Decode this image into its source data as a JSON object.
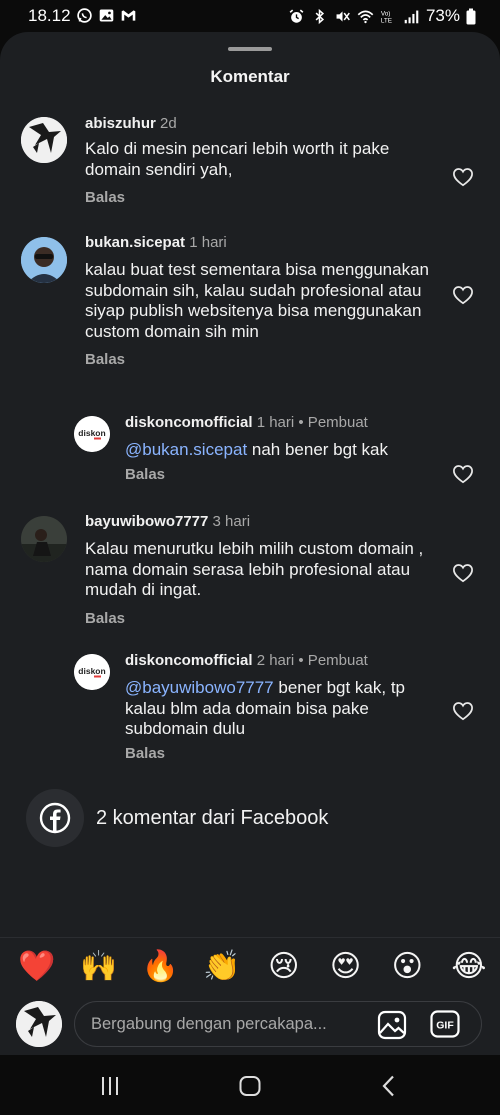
{
  "status": {
    "time": "18.12",
    "battery": "73%"
  },
  "sheet": {
    "title": "Komentar"
  },
  "comments": [
    {
      "username": "abiszuhur",
      "meta": "2d",
      "text": "Kalo di mesin pencari lebih worth it pake domain sendiri yah,",
      "reply_label": "Balas"
    },
    {
      "username": "bukan.sicepat",
      "meta": "1 hari",
      "text": "kalau buat test sementara bisa menggunakan subdomain sih, kalau sudah profesional atau siyap publish websitenya bisa menggunakan custom domain sih min",
      "reply_label": "Balas"
    },
    {
      "username": "diskoncomofficial",
      "meta": "1 hari • Pembuat",
      "mention": "@bukan.sicepat",
      "text": " nah bener bgt kak",
      "reply_label": "Balas"
    },
    {
      "username": "bayuwibowo7777",
      "meta": "3 hari",
      "text": "Kalau menurutku lebih milih custom domain , nama domain serasa lebih profesional atau mudah di ingat.",
      "reply_label": "Balas"
    },
    {
      "username": "diskoncomofficial",
      "meta": "2 hari • Pembuat",
      "mention": "@bayuwibowo7777",
      "text": " bener bgt kak, tp kalau blm ada domain bisa pake subdomain dulu",
      "reply_label": "Balas"
    }
  ],
  "facebook": {
    "label": "2 komentar dari Facebook"
  },
  "emojis": [
    "❤️",
    "🙌",
    "🔥",
    "👏",
    "😢",
    "😍",
    "😮",
    "😂"
  ],
  "composer": {
    "placeholder": "Bergabung dengan percakapa..."
  },
  "logo_text": "diskon",
  "colors": {
    "background": "#1d1f22",
    "mention": "#8ab4ff",
    "muted": "#a8a8a8"
  }
}
